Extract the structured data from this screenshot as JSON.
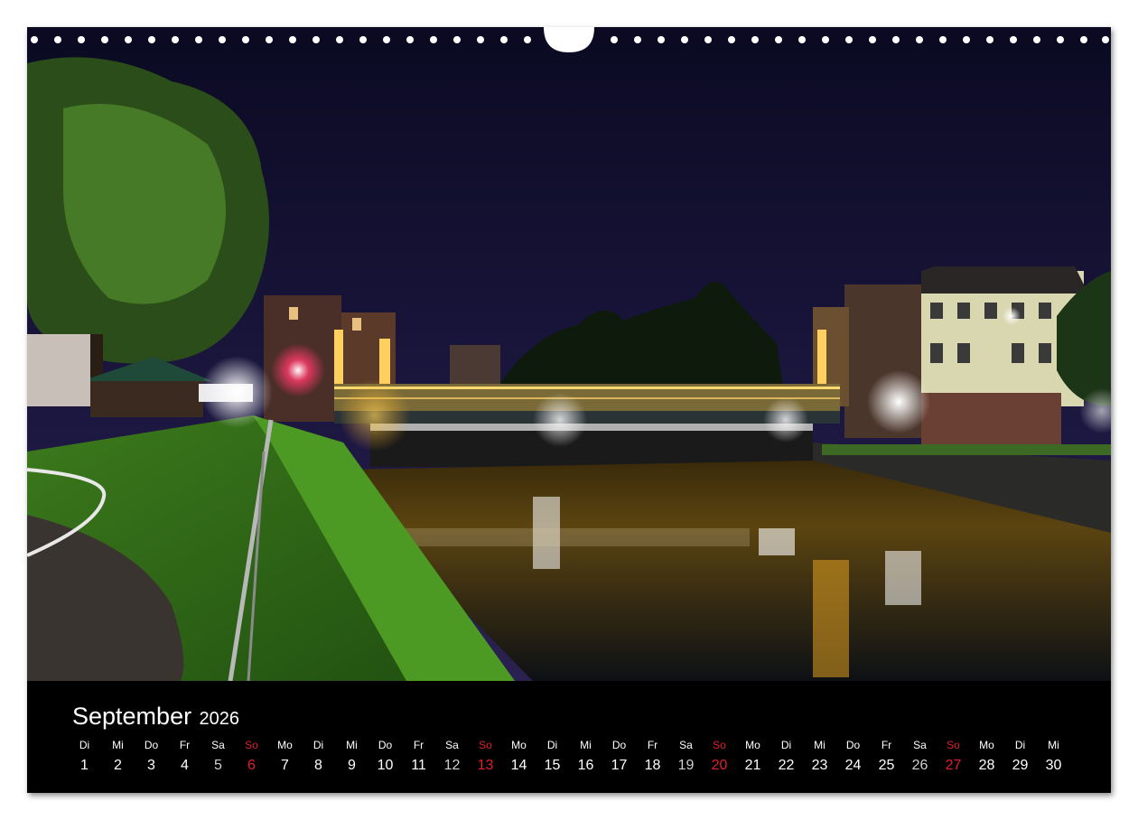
{
  "calendar": {
    "month": "September",
    "year": "2026",
    "days": [
      {
        "dow": "Di",
        "num": "1",
        "type": "weekday"
      },
      {
        "dow": "Mi",
        "num": "2",
        "type": "weekday"
      },
      {
        "dow": "Do",
        "num": "3",
        "type": "weekday"
      },
      {
        "dow": "Fr",
        "num": "4",
        "type": "weekday"
      },
      {
        "dow": "Sa",
        "num": "5",
        "type": "sat"
      },
      {
        "dow": "So",
        "num": "6",
        "type": "sun"
      },
      {
        "dow": "Mo",
        "num": "7",
        "type": "weekday"
      },
      {
        "dow": "Di",
        "num": "8",
        "type": "weekday"
      },
      {
        "dow": "Mi",
        "num": "9",
        "type": "weekday"
      },
      {
        "dow": "Do",
        "num": "10",
        "type": "weekday"
      },
      {
        "dow": "Fr",
        "num": "11",
        "type": "weekday"
      },
      {
        "dow": "Sa",
        "num": "12",
        "type": "sat"
      },
      {
        "dow": "So",
        "num": "13",
        "type": "sun"
      },
      {
        "dow": "Mo",
        "num": "14",
        "type": "weekday"
      },
      {
        "dow": "Di",
        "num": "15",
        "type": "weekday"
      },
      {
        "dow": "Mi",
        "num": "16",
        "type": "weekday"
      },
      {
        "dow": "Do",
        "num": "17",
        "type": "weekday"
      },
      {
        "dow": "Fr",
        "num": "18",
        "type": "weekday"
      },
      {
        "dow": "Sa",
        "num": "19",
        "type": "sat"
      },
      {
        "dow": "So",
        "num": "20",
        "type": "sun"
      },
      {
        "dow": "Mo",
        "num": "21",
        "type": "weekday"
      },
      {
        "dow": "Di",
        "num": "22",
        "type": "weekday"
      },
      {
        "dow": "Mi",
        "num": "23",
        "type": "weekday"
      },
      {
        "dow": "Do",
        "num": "24",
        "type": "weekday"
      },
      {
        "dow": "Fr",
        "num": "25",
        "type": "weekday"
      },
      {
        "dow": "Sa",
        "num": "26",
        "type": "sat"
      },
      {
        "dow": "So",
        "num": "27",
        "type": "sun"
      },
      {
        "dow": "Mo",
        "num": "28",
        "type": "weekday"
      },
      {
        "dow": "Di",
        "num": "29",
        "type": "weekday"
      },
      {
        "dow": "Mi",
        "num": "30",
        "type": "weekday"
      }
    ]
  },
  "colors": {
    "sunday": "#e0202a",
    "background": "#000000",
    "text": "#ffffff"
  }
}
